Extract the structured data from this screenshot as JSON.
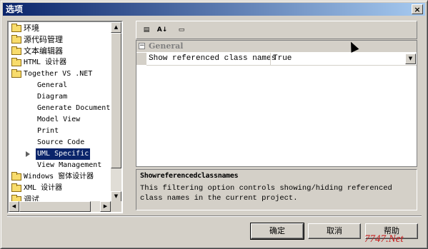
{
  "window": {
    "title": "选项",
    "close_label": "×"
  },
  "tree": {
    "items": [
      {
        "label": "环境",
        "kind": "folder"
      },
      {
        "label": "源代码管理",
        "kind": "folder"
      },
      {
        "label": "文本编辑器",
        "kind": "folder"
      },
      {
        "label": "HTML 设计器",
        "kind": "folder"
      },
      {
        "label": "Together VS .NET",
        "kind": "folder-open"
      },
      {
        "label": "General",
        "kind": "child"
      },
      {
        "label": "Diagram",
        "kind": "child"
      },
      {
        "label": "Generate Document",
        "kind": "child"
      },
      {
        "label": "Model View",
        "kind": "child"
      },
      {
        "label": "Print",
        "kind": "child"
      },
      {
        "label": "Source Code",
        "kind": "child"
      },
      {
        "label": "UML Specific",
        "kind": "child",
        "selected": true
      },
      {
        "label": "View Management",
        "kind": "child"
      },
      {
        "label": "Windows 窗体设计器",
        "kind": "folder"
      },
      {
        "label": "XML 设计器",
        "kind": "folder"
      },
      {
        "label": "调试",
        "kind": "folder"
      }
    ],
    "scroll_up_icon": "▲",
    "scroll_down_icon": "▼",
    "scroll_left_icon": "◀",
    "scroll_right_icon": "▶"
  },
  "toolbar": {
    "categorized_icon": "▤",
    "alphabetical_icon": "A↓",
    "pages_icon": "▭"
  },
  "grid": {
    "category": "General",
    "expander": "−",
    "property_name": "Show referenced class names",
    "property_value": "True",
    "dropdown_icon": "▼"
  },
  "description": {
    "title": "Showreferencedclassnames",
    "text": "This filtering option controls showing/hiding referenced class names in the current project."
  },
  "buttons": {
    "ok": "确定",
    "cancel": "取消",
    "help": "帮助"
  },
  "watermark": "7747.Net"
}
